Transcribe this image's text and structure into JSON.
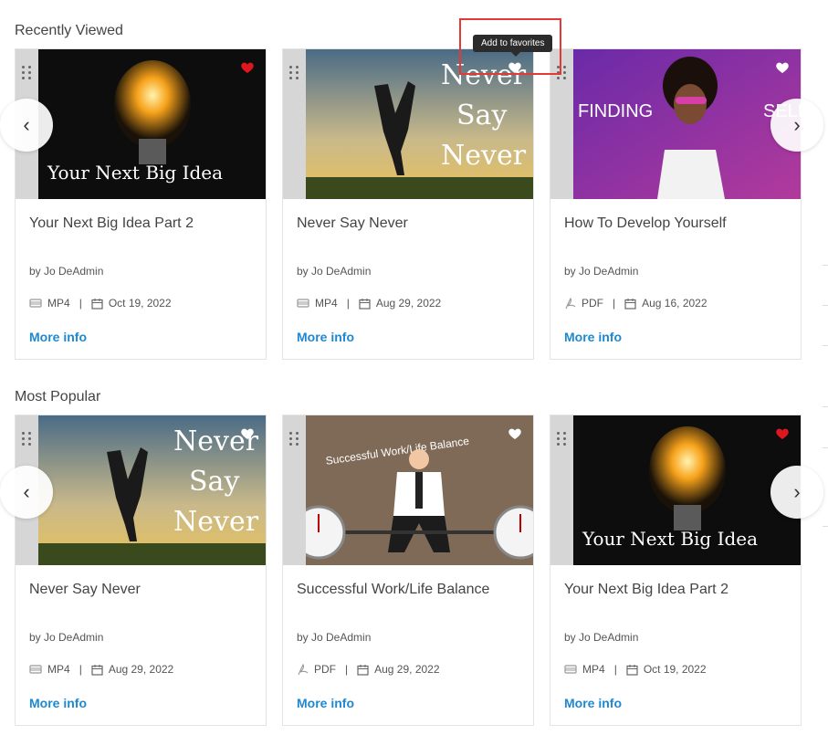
{
  "sections": [
    {
      "title": "Recently Viewed",
      "cards": [
        {
          "title": "Your Next Big Idea Part 2",
          "author": "by Jo DeAdmin",
          "type": "MP4",
          "date": "Oct 19, 2022",
          "more": "More info",
          "favorite": true,
          "art_text": "Your Next Big Idea"
        },
        {
          "title": "Never Say Never",
          "author": "by Jo DeAdmin",
          "type": "MP4",
          "date": "Aug 29, 2022",
          "more": "More info",
          "favorite": false,
          "art_text_1": "Never",
          "art_text_2": "Say",
          "art_text_3": "Never"
        },
        {
          "title": "How To Develop Yourself",
          "author": "by Jo DeAdmin",
          "type": "PDF",
          "date": "Aug 16, 2022",
          "more": "More info",
          "favorite": false,
          "art_text_1": "FINDING",
          "art_text_2": "SELF"
        }
      ]
    },
    {
      "title": "Most Popular",
      "cards": [
        {
          "title": "Never Say Never",
          "author": "by Jo DeAdmin",
          "type": "MP4",
          "date": "Aug 29, 2022",
          "more": "More info",
          "favorite": false,
          "art_text_1": "Never",
          "art_text_2": "Say",
          "art_text_3": "Never"
        },
        {
          "title": "Successful Work/Life Balance",
          "author": "by Jo DeAdmin",
          "type": "PDF",
          "date": "Aug 29, 2022",
          "more": "More info",
          "favorite": false,
          "art_text": "Successful Work/Life Balance"
        },
        {
          "title": "Your Next Big Idea Part 2",
          "author": "by Jo DeAdmin",
          "type": "MP4",
          "date": "Oct 19, 2022",
          "more": "More info",
          "favorite": true,
          "art_text": "Your Next Big Idea"
        }
      ]
    }
  ],
  "tooltip": "Add to favorites",
  "nav": {
    "prev": "‹",
    "next": "›"
  },
  "colors": {
    "accent": "#1e88d0",
    "favorite": "#e0161e",
    "tooltip_bg": "#2b2b2b",
    "highlight": "#e53935"
  }
}
